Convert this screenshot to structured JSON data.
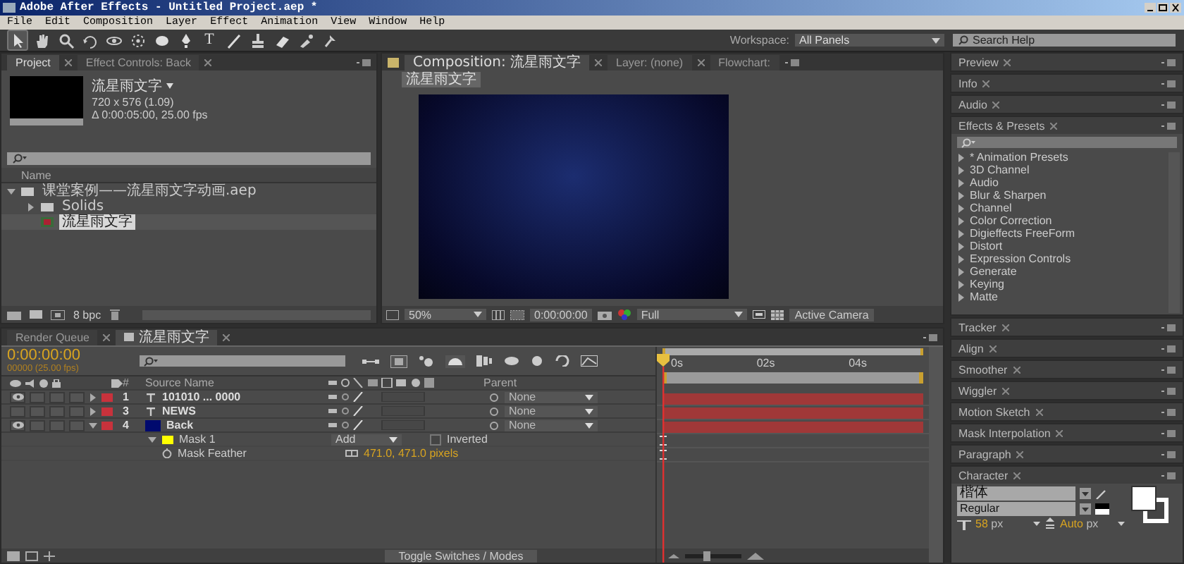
{
  "window": {
    "title": "Adobe After Effects - Untitled Project.aep *"
  },
  "menu": [
    "File",
    "Edit",
    "Composition",
    "Layer",
    "Effect",
    "Animation",
    "View",
    "Window",
    "Help"
  ],
  "toolbar": {
    "tools": [
      {
        "kind": "arrow",
        "selected": true
      },
      {
        "kind": "hand",
        "selected": false
      },
      {
        "kind": "zoom",
        "selected": false
      },
      {
        "kind": "rotate",
        "selected": false
      },
      {
        "kind": "orbit",
        "selected": false
      },
      {
        "kind": "pan",
        "selected": false
      },
      {
        "kind": "ellipse",
        "selected": false
      },
      {
        "kind": "pen",
        "selected": false
      },
      {
        "kind": "type",
        "glyph": "T",
        "selected": false
      },
      {
        "kind": "brush",
        "selected": false
      },
      {
        "kind": "stamp",
        "selected": false
      },
      {
        "kind": "eraser",
        "selected": false
      },
      {
        "kind": "roto",
        "selected": false
      },
      {
        "kind": "pin",
        "selected": false
      }
    ],
    "workspace_label": "Workspace:",
    "workspace": "All Panels",
    "search_help": {
      "placeholder": "Search Help"
    }
  },
  "project": {
    "tabs": [
      {
        "label": "Project",
        "selected": true
      },
      {
        "label": "Effect Controls: Back",
        "selected": false
      }
    ],
    "comp_name": "流星雨文字",
    "size": "720 x 576 (1.09)",
    "duration": "Δ 0:00:05:00, 25.00 fps",
    "column": "Name",
    "tree": [
      {
        "label": "课堂案例——流星雨文字动画.aep",
        "kind": "folder",
        "expanded": true,
        "selected": false,
        "children": [
          {
            "label": "Solids",
            "kind": "folder",
            "expanded": false,
            "selected": false
          },
          {
            "label": "流星雨文字",
            "kind": "comp",
            "selected": true
          }
        ]
      }
    ],
    "bit_depth": "8 bpc"
  },
  "composition": {
    "tabs": [
      {
        "label": "Composition: 流星雨文字",
        "selected": true
      },
      {
        "label": "Layer: (none)",
        "selected": false
      },
      {
        "label": "Flowchart:",
        "selected": false
      }
    ],
    "breadcrumb": "流星雨文字",
    "zoom": "50%",
    "time": "0:00:00:00",
    "resolution": "Full",
    "camera": "Active Camera"
  },
  "timeline": {
    "tabs": [
      {
        "label": "Render Queue",
        "selected": false
      },
      {
        "label": "流星雨文字",
        "selected": true
      }
    ],
    "timecode": "0:00:00:00",
    "frame_info": "00000 (25.00 fps)",
    "columns": [
      "#",
      "Source Name",
      "Parent"
    ],
    "layers": [
      {
        "number": "1",
        "kind": "text",
        "name": "101010 ... 0000",
        "visible": true,
        "expanded": false,
        "color": "#c8323c",
        "parent": "None"
      },
      {
        "number": "3",
        "kind": "text",
        "name": "NEWS",
        "visible": false,
        "expanded": false,
        "color": "#c8323c",
        "parent": "None"
      },
      {
        "number": "4",
        "kind": "solid",
        "name": "Back",
        "visible": true,
        "expanded": true,
        "color": "#c8323c",
        "parent": "None"
      }
    ],
    "zoom": {
      "level": 0.35
    },
    "mask": {
      "name": "Mask 1",
      "color": "#ffff00",
      "mode": "Add",
      "inverted_label": "Inverted",
      "inverted": false,
      "expanded": true
    },
    "mask_feather": {
      "name": "Mask Feather",
      "value": "471.0, 471.0 pixels"
    },
    "ruler": [
      "0s",
      "02s",
      "04s"
    ],
    "toggle": "Toggle Switches / Modes"
  },
  "panels_upper": [
    {
      "title": "Preview"
    },
    {
      "title": "Info"
    },
    {
      "title": "Audio"
    }
  ],
  "effects": {
    "title": "Effects & Presets",
    "items": [
      "* Animation Presets",
      "3D Channel",
      "Audio",
      "Blur & Sharpen",
      "Channel",
      "Color Correction",
      "Digieffects FreeForm",
      "Distort",
      "Expression Controls",
      "Generate",
      "Keying",
      "Matte"
    ]
  },
  "panels_lower": [
    {
      "title": "Tracker"
    },
    {
      "title": "Align"
    },
    {
      "title": "Smoother"
    },
    {
      "title": "Wiggler"
    },
    {
      "title": "Motion Sketch"
    },
    {
      "title": "Mask Interpolation"
    },
    {
      "title": "Paragraph"
    }
  ],
  "character": {
    "title": "Character",
    "font": "楷体",
    "style": "Regular",
    "size": "58",
    "size_unit": "px",
    "leading": "Auto",
    "leading_unit": "px"
  }
}
